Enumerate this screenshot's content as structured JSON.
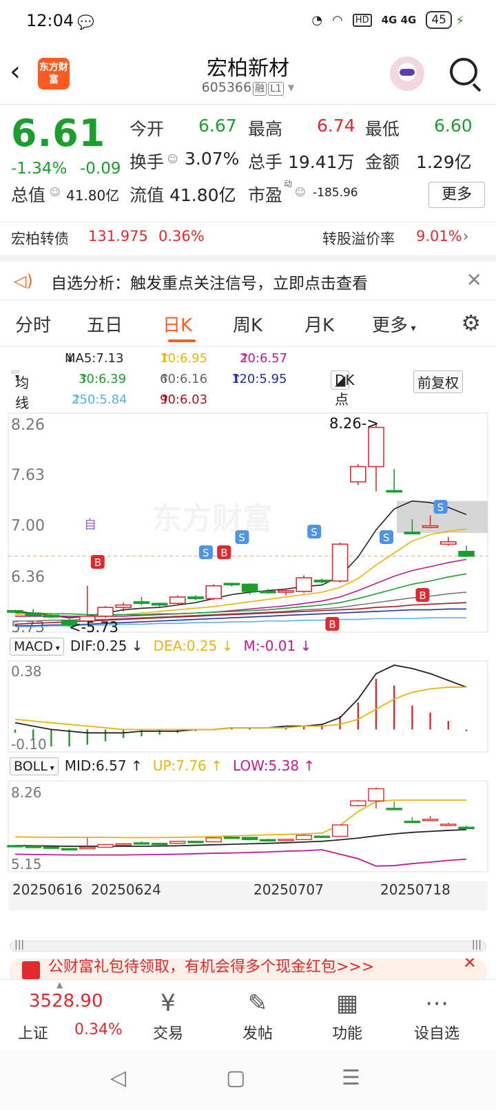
{
  "status": {
    "time": "12:04",
    "battery": "45",
    "signal": "4G 4G",
    "hd": "HD"
  },
  "header": {
    "logo": "东方财富",
    "title": "宏柏新材",
    "code": "605366",
    "tag1": "融",
    "tag2": "L1"
  },
  "quote": {
    "price": "6.61",
    "pct": "-1.34%",
    "chg": "-0.09",
    "open_label": "今开",
    "open": "6.67",
    "high_label": "最高",
    "high": "6.74",
    "low_label": "最低",
    "low": "6.60",
    "turnover_label": "换手",
    "turnover": "3.07%",
    "vol_label": "总手",
    "vol": "19.41万",
    "amt_label": "金额",
    "amt": "1.29亿",
    "mcap_label": "总值",
    "mcap": "41.80亿",
    "float_label": "流值",
    "float": "41.80亿",
    "pe_label": "市盈",
    "pe_sup": "动",
    "pe": "-185.96",
    "more": "更多"
  },
  "bond": {
    "name": "宏柏转债",
    "price": "131.975",
    "pct": "0.36%",
    "prem_label": "转股溢价率",
    "prem": "9.01%"
  },
  "notice": {
    "text": "自选分析：触发重点关注信号，立即点击查看"
  },
  "tabs": [
    "分时",
    "五日",
    "日K",
    "周K",
    "月K",
    "更多"
  ],
  "ma": {
    "ma5": "MA5:7.13",
    "ma10": "10:6.95",
    "ma20": "20:6.57",
    "ma30": "30:6.39",
    "ma60": "60:6.16",
    "ma120": "120:5.95",
    "ma250": "250:5.84",
    "ma90": "90:6.03",
    "btn_ma": "均线",
    "btn_dk": "DK点",
    "btn_fq": "前复权"
  },
  "kline": {
    "ymax": "8.26",
    "y2": "7.63",
    "y3": "7.00",
    "y4": "6.36",
    "ymin": "5.73",
    "annot_high": "8.26->",
    "annot_low": "<-5.73",
    "watermark": "东方财富",
    "mark_zi": "自"
  },
  "macd": {
    "btn": "MACD",
    "dif": "DIF:0.25",
    "dea": "DEA:0.25",
    "m": "M:-0.01",
    "ymax": "0.38",
    "ymin": "-0.10"
  },
  "boll": {
    "btn": "BOLL",
    "mid": "MID:6.57",
    "up": "UP:7.76",
    "low": "LOW:5.38",
    "ymax": "8.26",
    "ymin": "5.15"
  },
  "dates": [
    "20250616",
    "20250624",
    "20250707",
    "20250718"
  ],
  "banner": {
    "text": "公财富礼包待领取，有机会得多个现金红包>>>"
  },
  "bottom": {
    "index_value": "3528.90",
    "index_name": "上证",
    "index_pct": "0.34%",
    "items": [
      "交易",
      "发帖",
      "功能",
      "设自选"
    ]
  },
  "colors": {
    "up": "#e0292c",
    "down": "#1a9e2c",
    "accent": "#ff5a1f"
  },
  "chart_data": {
    "type": "candlestick",
    "x": [
      "d1",
      "d2",
      "d3",
      "d4",
      "d5",
      "d6",
      "d7",
      "d8",
      "d9",
      "d10",
      "d11",
      "d12",
      "d13",
      "d14",
      "d15",
      "d16",
      "d17",
      "d18",
      "d19",
      "d20",
      "d21",
      "d22",
      "d23",
      "d24",
      "d25",
      "d26"
    ],
    "ohlc": [
      [
        5.93,
        5.94,
        5.9,
        5.91
      ],
      [
        5.9,
        5.95,
        5.86,
        5.87
      ],
      [
        5.87,
        5.89,
        5.84,
        5.85
      ],
      [
        5.81,
        5.83,
        5.73,
        5.75
      ],
      [
        5.8,
        6.24,
        5.78,
        5.86
      ],
      [
        5.86,
        5.99,
        5.84,
        5.97
      ],
      [
        5.97,
        6.03,
        5.92,
        6.0
      ],
      [
        6.04,
        6.1,
        6.0,
        6.02
      ],
      [
        6.02,
        6.03,
        5.98,
        6.0
      ],
      [
        6.02,
        6.12,
        6.0,
        6.1
      ],
      [
        6.1,
        6.12,
        6.06,
        6.08
      ],
      [
        6.08,
        6.26,
        6.06,
        6.24
      ],
      [
        6.27,
        6.28,
        6.23,
        6.26
      ],
      [
        6.26,
        6.27,
        6.13,
        6.17
      ],
      [
        6.17,
        6.2,
        6.14,
        6.16
      ],
      [
        6.16,
        6.2,
        6.12,
        6.18
      ],
      [
        6.17,
        6.37,
        6.15,
        6.34
      ],
      [
        6.31,
        6.33,
        6.27,
        6.29
      ],
      [
        6.3,
        6.78,
        6.28,
        6.76
      ],
      [
        7.54,
        7.76,
        7.5,
        7.73
      ],
      [
        7.73,
        8.26,
        7.42,
        8.22
      ],
      [
        7.43,
        7.7,
        7.4,
        7.42
      ],
      [
        6.91,
        7.07,
        6.88,
        6.89
      ],
      [
        6.97,
        7.12,
        6.96,
        6.99
      ],
      [
        6.76,
        6.85,
        6.74,
        6.79
      ],
      [
        6.67,
        6.74,
        6.6,
        6.61
      ]
    ]
  }
}
